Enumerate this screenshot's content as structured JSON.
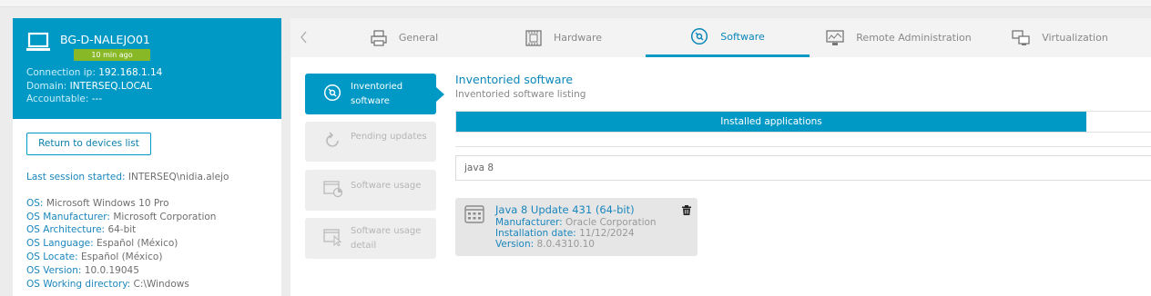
{
  "device": {
    "name": "BG-D-NALEJO01",
    "last_seen_badge": "10 min ago",
    "connection_ip_label": "Connection ip:",
    "connection_ip": "192.168.1.14",
    "domain_label": "Domain:",
    "domain": "INTERSEQ.LOCAL",
    "accountable_label": "Accountable:",
    "accountable": "---",
    "return_button": "Return to devices list"
  },
  "details": {
    "last_session_label": "Last session started:",
    "last_session": "INTERSEQ\\nidia.alejo",
    "os_label": "OS:",
    "os": "Microsoft Windows 10 Pro",
    "os_manufacturer_label": "OS Manufacturer:",
    "os_manufacturer": "Microsoft Corporation",
    "os_architecture_label": "OS Architecture:",
    "os_architecture": "64-bit",
    "os_language_label": "OS Language:",
    "os_language": "Español (México)",
    "os_locate_label": "OS Locate:",
    "os_locate": "Español (México)",
    "os_version_label": "OS Version:",
    "os_version": "10.0.19045",
    "os_working_dir_label": "OS Working directory:",
    "os_working_dir": "C:\\Windows"
  },
  "tabs": {
    "back_icon": "chevron-left-icon",
    "general": "General",
    "hardware": "Hardware",
    "software": "Software",
    "remote": "Remote Administration",
    "virtualization": "Virtualization",
    "active": "software"
  },
  "sidebar": {
    "inventoried_software": "Inventoried software",
    "pending_updates": "Pending updates",
    "software_usage": "Software usage",
    "software_usage_detail": "Software usage detail"
  },
  "content": {
    "title": "Inventoried software",
    "subtitle": "Inventoried software listing",
    "progress_label": "Installed applications",
    "progress_fraction": 0.907,
    "search_value": "java 8"
  },
  "software_item": {
    "name": "Java 8 Update 431 (64-bit)",
    "manufacturer_label": "Manufacturer:",
    "manufacturer": "Oracle Corporation",
    "install_date_label": "Installation date:",
    "install_date": "11/12/2024",
    "version_label": "Version:",
    "version": "8.0.4310.10"
  },
  "colors": {
    "accent": "#0099c6",
    "badge": "#88b825",
    "link": "#1a86bd"
  }
}
